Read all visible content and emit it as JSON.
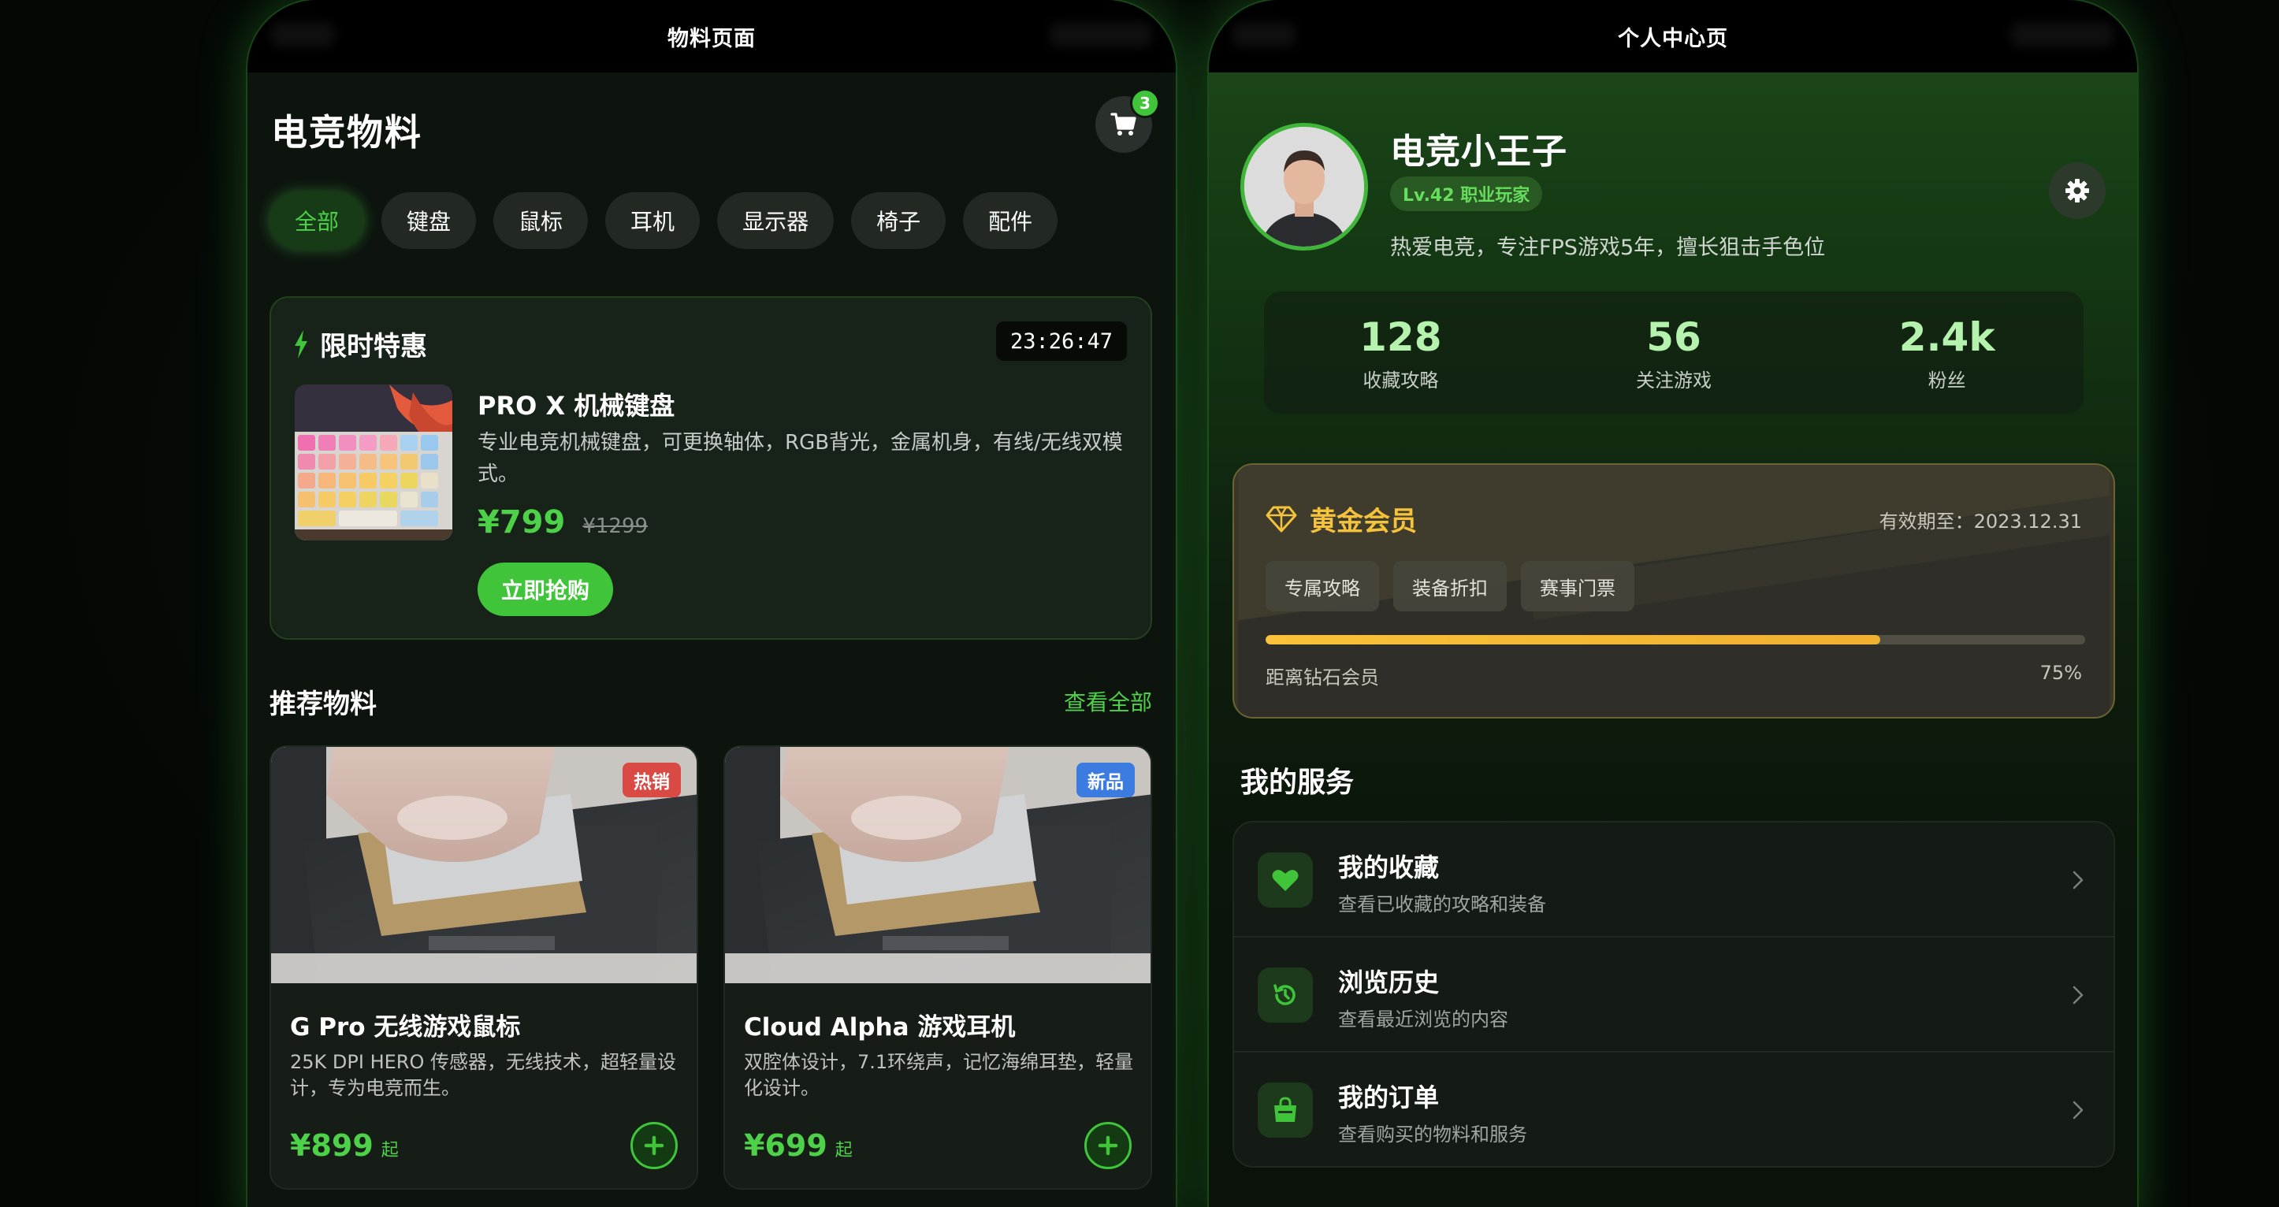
{
  "materials": {
    "status_title": "物料页面",
    "page_title": "电竞物料",
    "cart_count": "3",
    "categories": [
      "全部",
      "键盘",
      "鼠标",
      "耳机",
      "显示器",
      "椅子",
      "配件"
    ],
    "flash": {
      "title": "限时特惠",
      "timer": "23:26:47",
      "name": "PRO X 机械键盘",
      "desc": "专业电竞机械键盘，可更换轴体，RGB背光，金属机身，有线/无线双模式。",
      "price": "¥799",
      "old_price": "¥1299",
      "buy_label": "立即抢购"
    },
    "recommend_title": "推荐物料",
    "view_all": "查看全部",
    "products": [
      {
        "badge": "热销",
        "name": "G Pro 无线游戏鼠标",
        "desc": "25K DPI HERO 传感器，无线技术，超轻量设计，专为电竞而生。",
        "price": "¥899",
        "suffix": "起"
      },
      {
        "badge": "新品",
        "name": "Cloud Alpha 游戏耳机",
        "desc": "双腔体设计，7.1环绕声，记忆海绵耳垫，轻量化设计。",
        "price": "¥699",
        "suffix": "起"
      }
    ]
  },
  "profile": {
    "status_title": "个人中心页",
    "name": "电竞小王子",
    "level": "Lv.42 职业玩家",
    "bio": "热爱电竞，专注FPS游戏5年，擅长狙击手色位",
    "stats": [
      {
        "value": "128",
        "label": "收藏攻略"
      },
      {
        "value": "56",
        "label": "关注游戏"
      },
      {
        "value": "2.4k",
        "label": "粉丝"
      }
    ],
    "vip": {
      "title": "黄金会员",
      "expire": "有效期至：2023.12.31",
      "perks": [
        "专属攻略",
        "装备折扣",
        "赛事门票"
      ],
      "progress_hint": "距离钻石会员",
      "progress_text": "75%",
      "progress": 0.75
    },
    "services_title": "我的服务",
    "services": [
      {
        "name": "我的收藏",
        "desc": "查看已收藏的攻略和装备"
      },
      {
        "name": "浏览历史",
        "desc": "查看最近浏览的内容"
      },
      {
        "name": "我的订单",
        "desc": "查看购买的物料和服务"
      }
    ]
  },
  "colors": {
    "accent": "#3fc43a",
    "gold": "#f5c33b",
    "hot_badge": "#d94a45",
    "new_badge": "#3c7be0"
  }
}
